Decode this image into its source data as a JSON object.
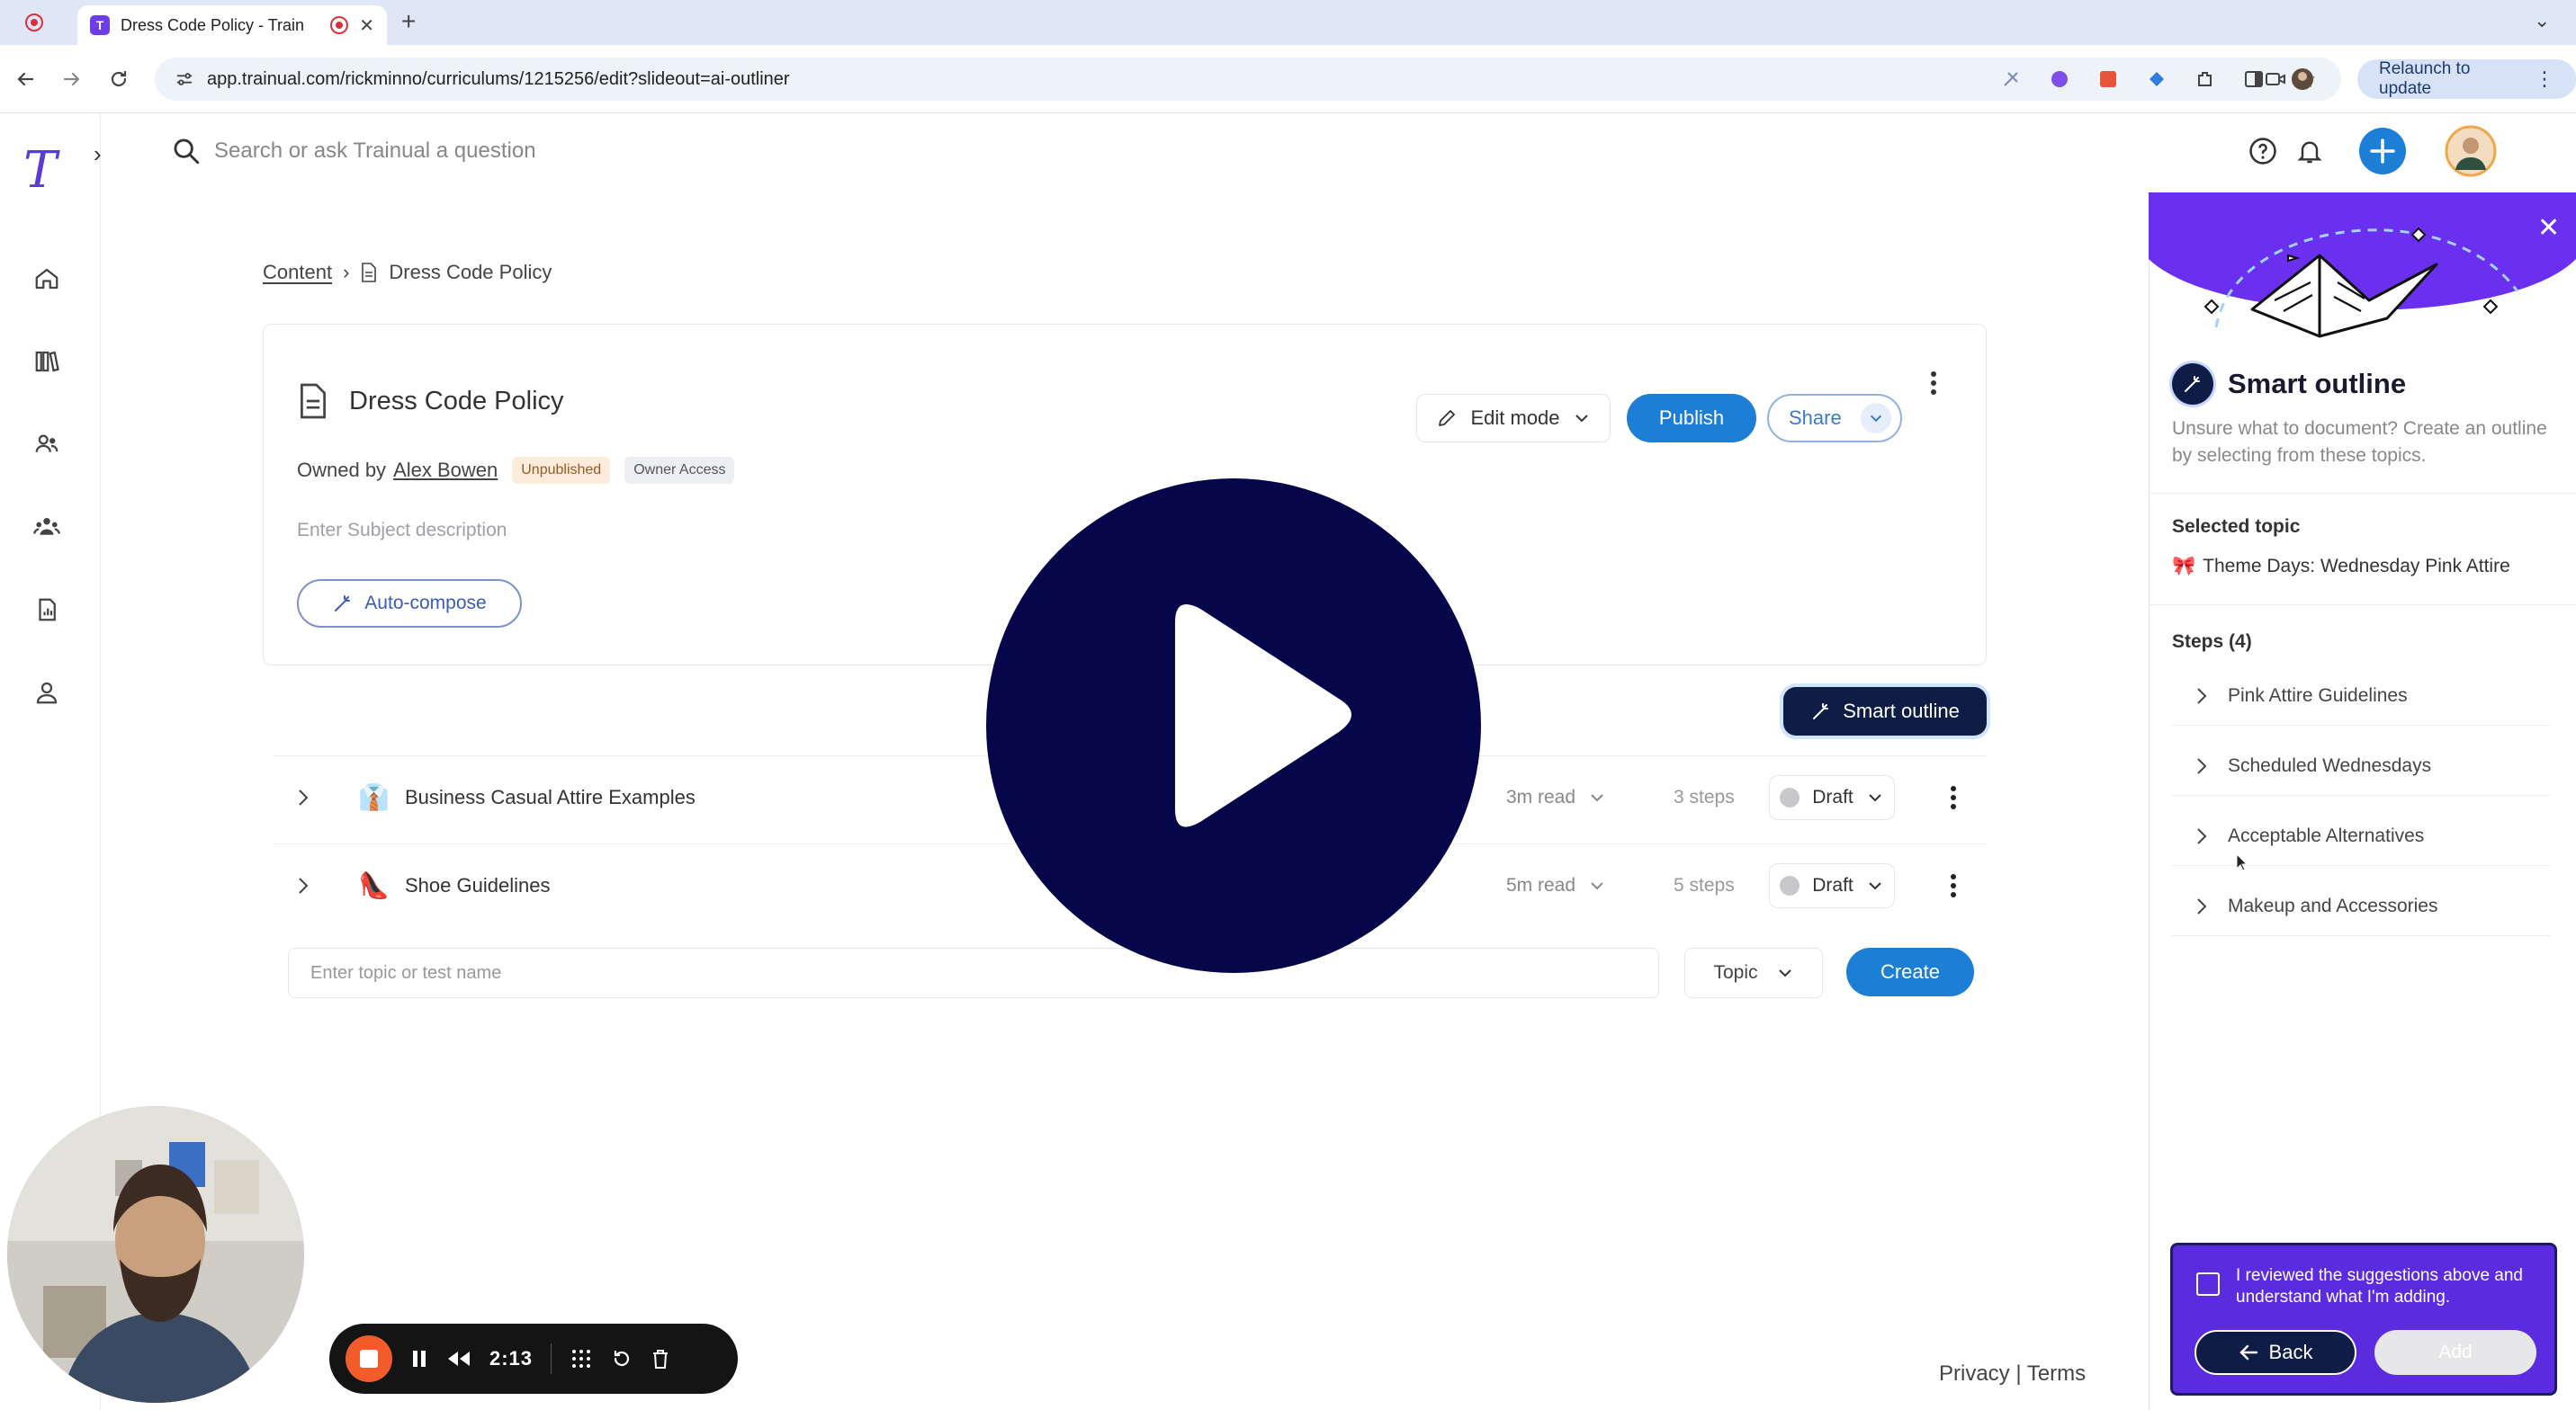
{
  "browser": {
    "tab_title": "Dress Code Policy - Train",
    "new_tab_symbol": "+",
    "url": "app.trainual.com/rickminno/curriculums/1215256/edit?slideout=ai-outliner",
    "relaunch_label": "Relaunch to update"
  },
  "app": {
    "logo_glyph": "T",
    "search_placeholder": "Search or ask Trainual a question",
    "nav_icons": [
      "home-icon",
      "library-icon",
      "people-icon",
      "groups-icon",
      "reports-icon",
      "profile-icon"
    ]
  },
  "breadcrumb": {
    "root": "Content",
    "current": "Dress Code Policy"
  },
  "subject": {
    "title": "Dress Code Policy",
    "owned_by_prefix": "Owned by",
    "owner_name": "Alex Bowen",
    "status_badge": "Unpublished",
    "access_badge": "Owner Access",
    "description_placeholder": "Enter Subject description",
    "auto_compose_label": "Auto-compose",
    "edit_mode_label": "Edit mode",
    "publish_label": "Publish",
    "share_label": "Share"
  },
  "smart_outline_button": "Smart outline",
  "topics": [
    {
      "emoji": "👔",
      "name": "Business Casual Attire Examples",
      "read": "3m read",
      "steps": "3 steps",
      "status": "Draft"
    },
    {
      "emoji": "👠",
      "name": "Shoe Guidelines",
      "read": "5m read",
      "steps": "5 steps",
      "status": "Draft"
    }
  ],
  "new_topic": {
    "placeholder": "Enter topic or test name",
    "type_label": "Topic",
    "create_label": "Create"
  },
  "footer": {
    "privacy": "Privacy",
    "separator": "|",
    "terms": "Terms"
  },
  "panel": {
    "title": "Smart outline",
    "description": "Unsure what to document? Create an outline by selecting from these topics.",
    "selected_topic_label": "Selected topic",
    "selected_topic_emoji": "🎀",
    "selected_topic": "Theme Days: Wednesday Pink Attire",
    "steps_label": "Steps (4)",
    "steps": [
      "Pink Attire Guidelines",
      "Scheduled Wednesdays",
      "Acceptable Alternatives",
      "Makeup and Accessories"
    ],
    "confirm_text": "I reviewed the suggestions above and understand what I'm adding.",
    "back_label": "Back",
    "add_label": "Add"
  },
  "recorder": {
    "time": "2:13"
  },
  "colors": {
    "primary_blue": "#1d7ed6",
    "navy": "#0f1c46",
    "panel_purple": "#5b2be0",
    "play_button": "#06064a",
    "record_orange": "#f25c2b"
  }
}
